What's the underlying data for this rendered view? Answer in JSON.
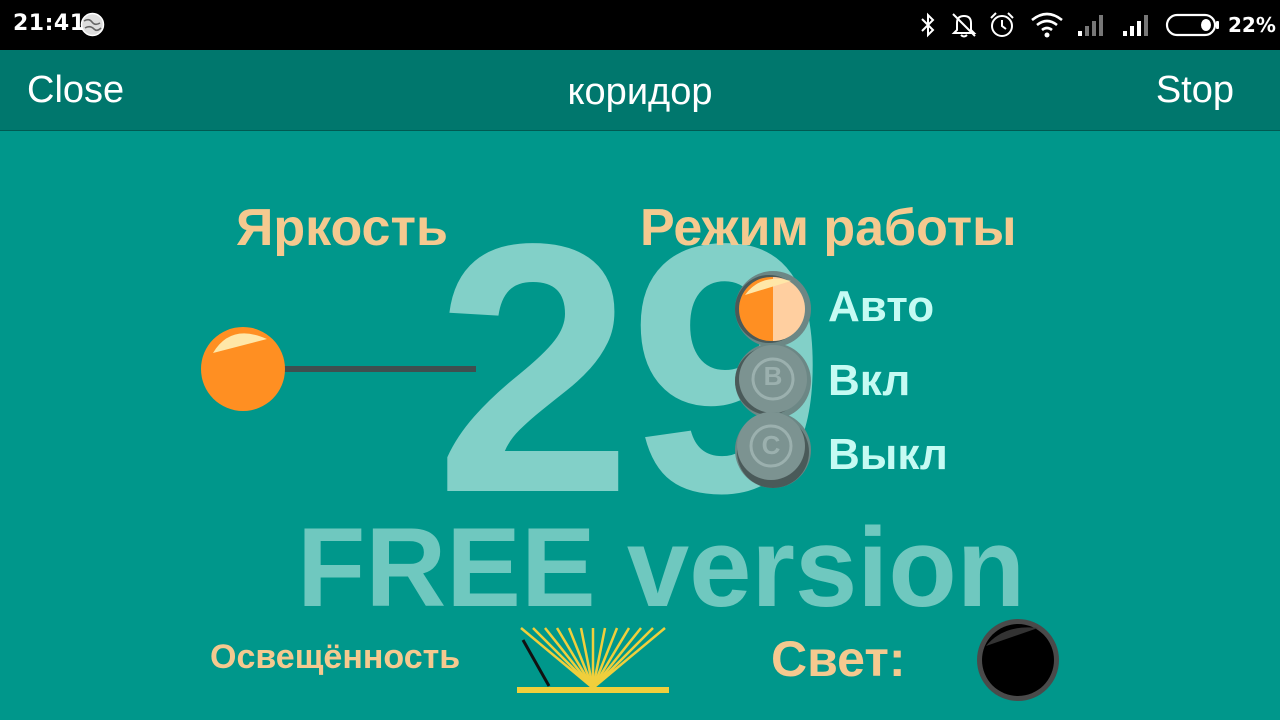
{
  "status_bar": {
    "time": "21:41",
    "battery_percent": "22%",
    "icons": [
      "globe-icon",
      "bluetooth-icon",
      "alarm-off-icon",
      "alarm-clock-icon",
      "wifi-icon",
      "signal-1-icon",
      "signal-2-icon",
      "battery-icon"
    ]
  },
  "app_bar": {
    "close_label": "Close",
    "title": "коридор",
    "stop_label": "Stop"
  },
  "brightness": {
    "label": "Яркость",
    "level": 0,
    "value": "29"
  },
  "mode": {
    "label": "Режим работы",
    "options": [
      {
        "label": "Авто",
        "badge": "",
        "selected": true
      },
      {
        "label": "Вкл",
        "badge": "B",
        "selected": false
      },
      {
        "label": "Выкл",
        "badge": "C",
        "selected": false
      }
    ]
  },
  "watermark": "FREE version",
  "illumination": {
    "label": "Освещённость"
  },
  "light": {
    "label": "Свет:"
  },
  "colors": {
    "background": "#00978b",
    "app_bar": "#00776d",
    "accent_orange": "#ff8f22",
    "label_peach": "#f5c98f",
    "option_text": "#c5fbf3",
    "big_number": "#82d0c8"
  }
}
